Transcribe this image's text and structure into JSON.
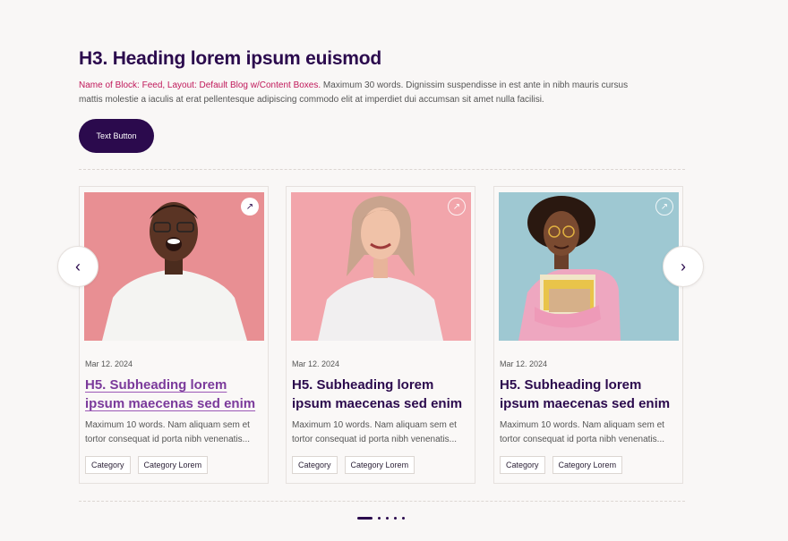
{
  "header": {
    "title": "H3. Heading lorem ipsum euismod",
    "meta_text": "Name of Block: Feed, Layout: Default Blog w/Content Boxes.",
    "description": " Maximum 30 words. Dignissim suspendisse in est ante in nibh mauris cursus mattis molestie a iaculis at erat pellentesque adipiscing commodo elit at imperdiet dui accumsan sit amet nulla facilisi.",
    "button_label": "Text Button"
  },
  "carousel": {
    "prev_icon": "chevron-left-icon",
    "next_icon": "chevron-right-icon",
    "prev_glyph": "‹",
    "next_glyph": "›",
    "cards": [
      {
        "image_icon": "smiling-man-photo",
        "image_bg": "#e88f93",
        "ext_glyph": "↗",
        "date": "Mar 12. 2024",
        "title": "H5. Subheading lorem ipsum maecenas sed enim",
        "body": "Maximum 10 words. Nam aliquam sem et tortor consequat id porta nibh venenatis...",
        "categories": [
          "Category",
          "Category Lorem"
        ]
      },
      {
        "image_icon": "smiling-woman-photo",
        "image_bg": "#f2a5ab",
        "ext_glyph": "↗",
        "date": "Mar 12. 2024",
        "title": "H5. Subheading lorem ipsum maecenas sed enim",
        "body": "Maximum 10 words. Nam aliquam sem et tortor consequat id porta nibh venenatis...",
        "categories": [
          "Category",
          "Category Lorem"
        ]
      },
      {
        "image_icon": "woman-with-books-photo",
        "image_bg": "#9ec8d2",
        "ext_glyph": "↗",
        "date": "Mar 12. 2024",
        "title": "H5. Subheading lorem ipsum maecenas sed enim",
        "body": "Maximum 10 words. Nam aliquam sem et tortor consequat id porta nibh venenatis...",
        "categories": [
          "Category",
          "Category Lorem"
        ]
      }
    ],
    "pagination": {
      "total": 5,
      "active": 1
    }
  },
  "colors": {
    "brand": "#2b0a4d",
    "accent": "#c0185a",
    "link": "#7b3a9b"
  }
}
